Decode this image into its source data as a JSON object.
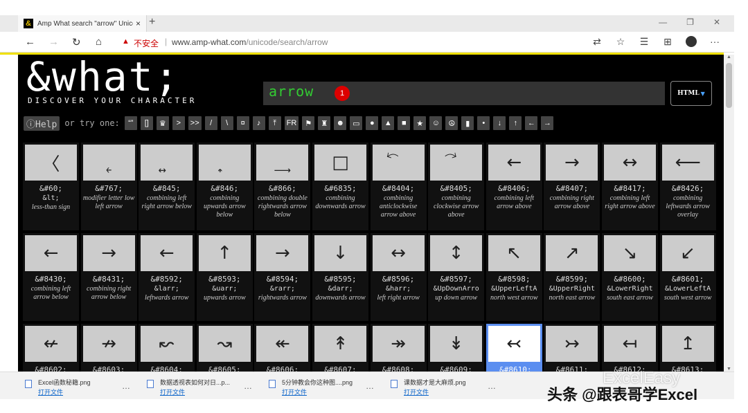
{
  "browser": {
    "tab_title": "Amp What search \"arrow\" Unico",
    "tab_close": "×",
    "new_tab": "+",
    "win_min": "—",
    "win_max": "❐",
    "win_close": "✕",
    "nav_back": "←",
    "nav_forward": "→",
    "nav_refresh": "↻",
    "nav_home": "⌂",
    "lock_icon": "▲",
    "insecure": "不安全",
    "sep": "|",
    "url_host": "www.amp-what.com",
    "url_path": "/unicode/search/arrow",
    "icon_translate": "⇄",
    "icon_star": "☆",
    "icon_favs": "☰",
    "icon_collections": "⊞",
    "icon_more": "···"
  },
  "site": {
    "favicon": "&",
    "logo": "&what;",
    "tagline": "DISCOVER YOUR CHARACTER",
    "search_value": "arrow",
    "result_badge": "1",
    "html_button": "HTML",
    "html_caret": "▼",
    "help": "ⓘHelp",
    "try_one": "or try one:",
    "chips": [
      "“”",
      "[]",
      "♛",
      ">",
      ">>",
      "/",
      "\\",
      "¤",
      "♪",
      "⤒",
      "FR",
      "⚑",
      "♜",
      "☻",
      "▭",
      "●",
      "▲",
      "■",
      "★",
      "☺",
      "☮",
      "▮",
      "•",
      "↓",
      "↑",
      "←",
      "→"
    ]
  },
  "grid_rows": [
    [
      {
        "sym": "〈",
        "code": "&#60;",
        "ent": "&lt;",
        "desc": "less-than sign"
      },
      {
        "sym": "˿",
        "code": "&#767;",
        "ent": "",
        "desc": "modifier letter low left arrow"
      },
      {
        "sym": "͍",
        "code": "&#845;",
        "ent": "",
        "desc": "combining left right arrow below"
      },
      {
        "sym": "͎",
        "code": "&#846;",
        "ent": "",
        "desc": "combining upwards arrow below"
      },
      {
        "sym": "͢",
        "code": "&#866;",
        "ent": "",
        "desc": "combining double rightwards arrow below"
      },
      {
        "sym": "□",
        "code": "&#6835;",
        "ent": "",
        "desc": "combining downwards arrow"
      },
      {
        "sym": "⃔",
        "code": "&#8404;",
        "ent": "",
        "desc": "combining anticlockwise arrow above"
      },
      {
        "sym": "⃕",
        "code": "&#8405;",
        "ent": "",
        "desc": "combining clockwise arrow above"
      },
      {
        "sym": "←",
        "code": "&#8406;",
        "ent": "",
        "desc": "combining left arrow above"
      },
      {
        "sym": "→",
        "code": "&#8407;",
        "ent": "",
        "desc": "combining right arrow above"
      },
      {
        "sym": "↔",
        "code": "&#8417;",
        "ent": "",
        "desc": "combining left right arrow above"
      },
      {
        "sym": "⟵",
        "code": "&#8426;",
        "ent": "",
        "desc": "combining leftwards arrow overlay"
      }
    ],
    [
      {
        "sym": "←",
        "code": "&#8430;",
        "ent": "",
        "desc": "combining left arrow below"
      },
      {
        "sym": "→",
        "code": "&#8431;",
        "ent": "",
        "desc": "combining right arrow below"
      },
      {
        "sym": "←",
        "code": "&#8592;",
        "ent": "&larr;",
        "desc": "leftwards arrow"
      },
      {
        "sym": "↑",
        "code": "&#8593;",
        "ent": "&uarr;",
        "desc": "upwards arrow"
      },
      {
        "sym": "→",
        "code": "&#8594;",
        "ent": "&rarr;",
        "desc": "rightwards arrow"
      },
      {
        "sym": "↓",
        "code": "&#8595;",
        "ent": "&darr;",
        "desc": "downwards arrow"
      },
      {
        "sym": "↔",
        "code": "&#8596;",
        "ent": "&harr;",
        "desc": "left right arrow"
      },
      {
        "sym": "↕",
        "code": "&#8597;",
        "ent": "&UpDownArro",
        "desc": "up down arrow"
      },
      {
        "sym": "↖",
        "code": "&#8598;",
        "ent": "&UpperLeftA",
        "desc": "north west arrow"
      },
      {
        "sym": "↗",
        "code": "&#8599;",
        "ent": "&UpperRight",
        "desc": "north east arrow"
      },
      {
        "sym": "↘",
        "code": "&#8600;",
        "ent": "&LowerRight",
        "desc": "south east arrow"
      },
      {
        "sym": "↙",
        "code": "&#8601;",
        "ent": "&LowerLeftA",
        "desc": "south west arrow"
      }
    ],
    [
      {
        "sym": "↚",
        "code": "&#8602;",
        "ent": "",
        "desc": ""
      },
      {
        "sym": "↛",
        "code": "&#8603;",
        "ent": "",
        "desc": ""
      },
      {
        "sym": "↜",
        "code": "&#8604;",
        "ent": "",
        "desc": ""
      },
      {
        "sym": "↝",
        "code": "&#8605;",
        "ent": "",
        "desc": ""
      },
      {
        "sym": "↞",
        "code": "&#8606;",
        "ent": "",
        "desc": ""
      },
      {
        "sym": "↟",
        "code": "&#8607;",
        "ent": "",
        "desc": ""
      },
      {
        "sym": "↠",
        "code": "&#8608;",
        "ent": "",
        "desc": ""
      },
      {
        "sym": "↡",
        "code": "&#8609;",
        "ent": "",
        "desc": ""
      },
      {
        "sym": "↢",
        "code": "&#8610;",
        "ent": "",
        "desc": ""
      },
      {
        "sym": "↣",
        "code": "&#8611;",
        "ent": "",
        "desc": ""
      },
      {
        "sym": "↤",
        "code": "&#8612;",
        "ent": "",
        "desc": ""
      },
      {
        "sym": "↥",
        "code": "&#8613;",
        "ent": "",
        "desc": ""
      }
    ]
  ],
  "selected_code": "&#8610;",
  "downloads": [
    {
      "name": "Excel函数秘籍.png",
      "open": "打开文件"
    },
    {
      "name": "数据透视表如何对日...p...",
      "open": "打开文件"
    },
    {
      "name": "5分钟教会你这种图....png",
      "open": "打开文件"
    },
    {
      "name": "课数据才是大麻烦.png",
      "open": "打开文件"
    }
  ],
  "download_more": "…",
  "watermark1": "ExcelEasy",
  "watermark2": "头条 @跟表哥学Excel"
}
